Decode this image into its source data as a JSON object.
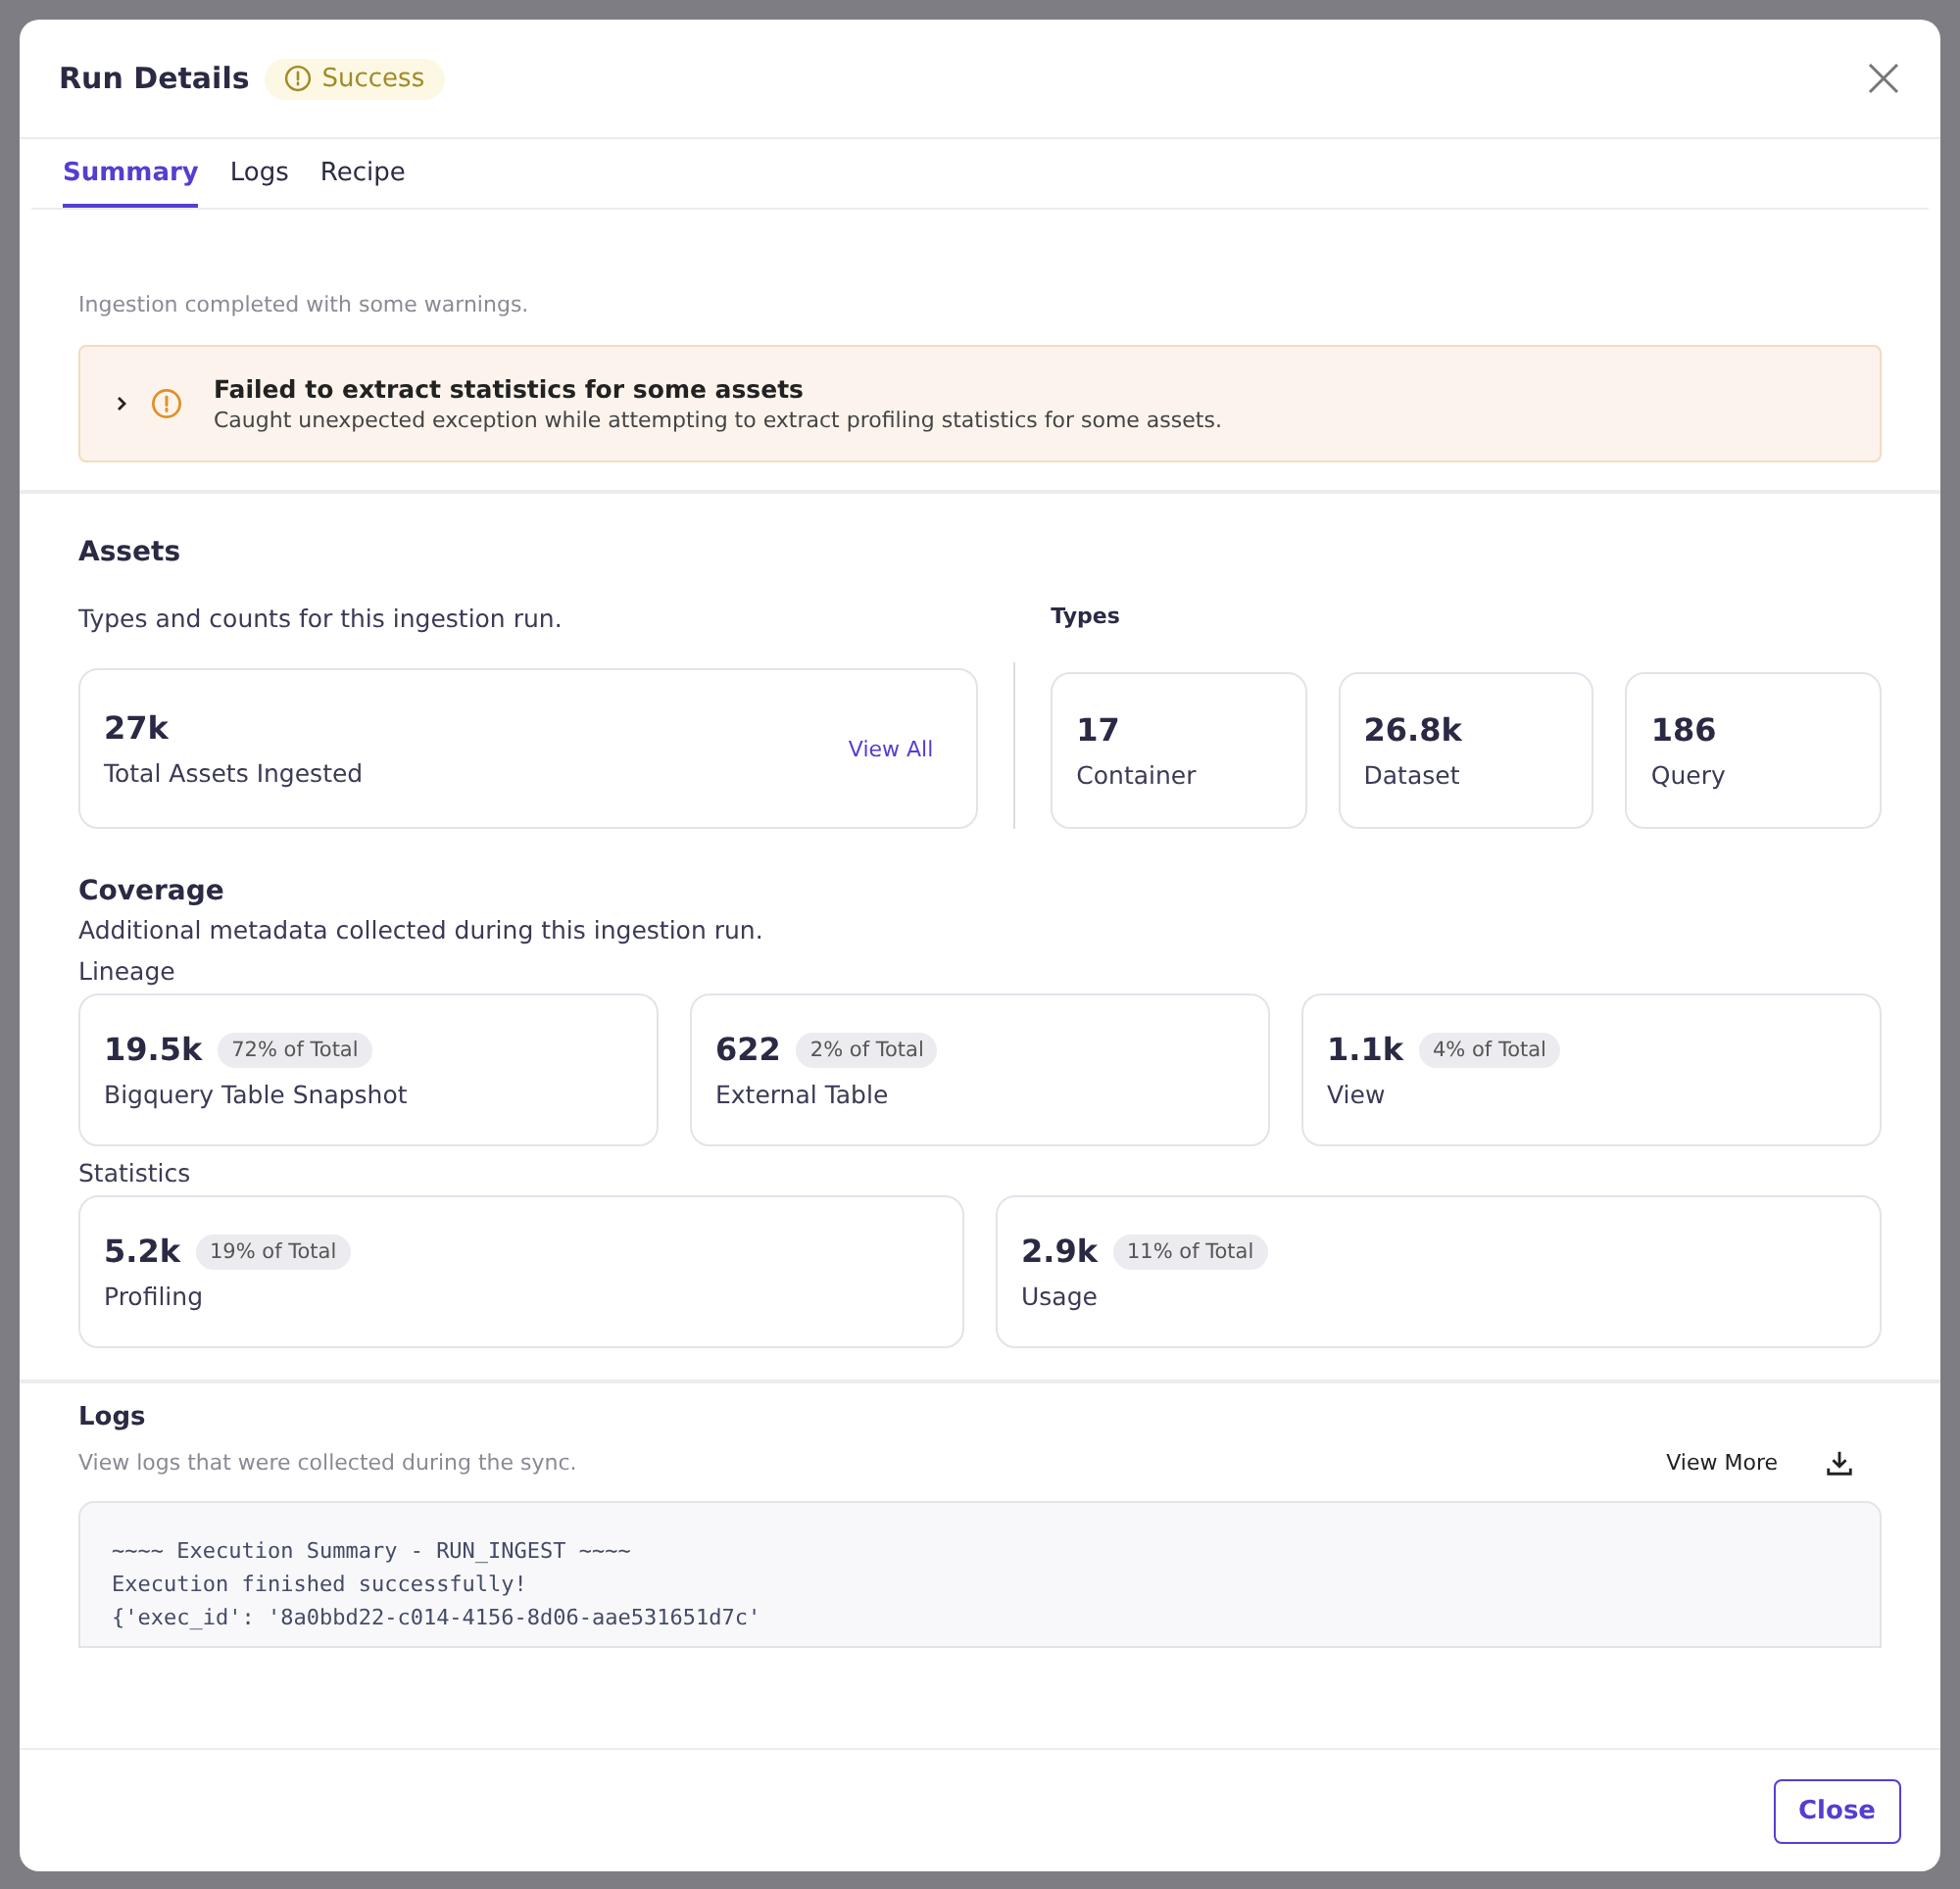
{
  "modal": {
    "title": "Run Details",
    "status": {
      "label": "Success",
      "kind": "warning"
    }
  },
  "tabs": [
    {
      "label": "Summary",
      "selected": true
    },
    {
      "label": "Logs",
      "selected": false
    },
    {
      "label": "Recipe",
      "selected": false
    }
  ],
  "summary": {
    "message": "Ingestion completed with some warnings.",
    "alerts": [
      {
        "title": "Failed to extract statistics for some assets",
        "detail": "Caught unexpected exception while attempting to extract profiling statistics for some assets.",
        "expanded": false
      }
    ]
  },
  "assets": {
    "title": "Assets",
    "subtitle": "Types and counts for this ingestion run.",
    "total": {
      "value": "27k",
      "label": "Total Assets Ingested",
      "link": "View All"
    },
    "types_title": "Types",
    "types": [
      {
        "value": "17",
        "label": "Container"
      },
      {
        "value": "26.8k",
        "label": "Dataset"
      },
      {
        "value": "186",
        "label": "Query"
      }
    ]
  },
  "coverage": {
    "title": "Coverage",
    "subtitle": "Additional metadata collected during this ingestion run.",
    "groups": [
      {
        "title": "Lineage",
        "items": [
          {
            "value": "19.5k",
            "share": "72% of Total",
            "label": "Bigquery Table Snapshot"
          },
          {
            "value": "622",
            "share": "2% of Total",
            "label": "External Table"
          },
          {
            "value": "1.1k",
            "share": "4% of Total",
            "label": "View"
          }
        ]
      },
      {
        "title": "Statistics",
        "items": [
          {
            "value": "5.2k",
            "share": "19% of Total",
            "label": "Profiling"
          },
          {
            "value": "2.9k",
            "share": "11% of Total",
            "label": "Usage"
          }
        ]
      }
    ]
  },
  "logs": {
    "title": "Logs",
    "subtitle": "View logs that were collected during the sync.",
    "more": "View More",
    "lines": [
      "~~~~ Execution Summary - RUN_INGEST ~~~~",
      "Execution finished successfully!",
      "{'exec_id': '8a0bbd22-c014-4156-8d06-aae531651d7c'"
    ]
  },
  "footer": {
    "close": "Close"
  }
}
